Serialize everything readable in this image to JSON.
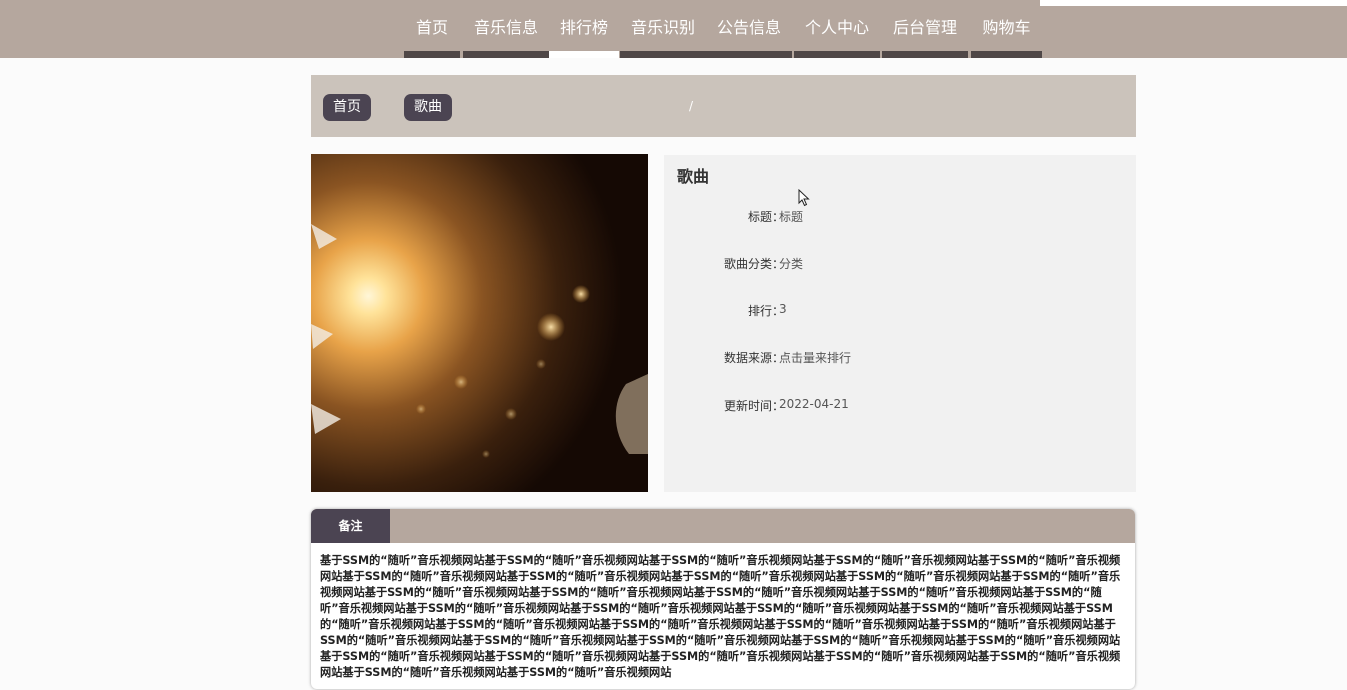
{
  "nav": {
    "items": [
      {
        "label": "首页"
      },
      {
        "label": "音乐信息"
      },
      {
        "label": "排行榜"
      },
      {
        "label": "音乐识别"
      },
      {
        "label": "公告信息"
      },
      {
        "label": "个人中心"
      },
      {
        "label": "后台管理"
      },
      {
        "label": "购物车"
      }
    ],
    "active_index": 2
  },
  "breadcrumb": {
    "items": [
      {
        "label": "首页"
      },
      {
        "label": "歌曲"
      }
    ],
    "separator": "/"
  },
  "detail": {
    "title": "歌曲",
    "fields": [
      {
        "label": "标题：",
        "value": "标题"
      },
      {
        "label": "歌曲分类：",
        "value": "分类"
      },
      {
        "label": "排行：",
        "value": "3"
      },
      {
        "label": "数据来源：",
        "value": "点击量来排行"
      },
      {
        "label": "更新时间：",
        "value": "2022-04-21"
      }
    ]
  },
  "remarks": {
    "tab_label": "备注",
    "content": "基于SSM的“随听”音乐视频网站基于SSM的“随听”音乐视频网站基于SSM的“随听”音乐视频网站基于SSM的“随听”音乐视频网站基于SSM的“随听”音乐视频网站基于SSM的“随听”音乐视频网站基于SSM的“随听”音乐视频网站基于SSM的“随听”音乐视频网站基于SSM的“随听”音乐视频网站基于SSM的“随听”音乐视频网站基于SSM的“随听”音乐视频网站基于SSM的“随听”音乐视频网站基于SSM的“随听”音乐视频网站基于SSM的“随听”音乐视频网站基于SSM的“随听”音乐视频网站基于SSM的“随听”音乐视频网站基于SSM的“随听”音乐视频网站基于SSM的“随听”音乐视频网站基于SSM的“随听”音乐视频网站基于SSM的“随听”音乐视频网站基于SSM的“随听”音乐视频网站基于SSM的“随听”音乐视频网站基于SSM的“随听”音乐视频网站基于SSM的“随听”音乐视频网站基于SSM的“随听”音乐视频网站基于SSM的“随听”音乐视频网站基于SSM的“随听”音乐视频网站基于SSM的“随听”音乐视频网站基于SSM的“随听”音乐视频网站基于SSM的“随听”音乐视频网站基于SSM的“随听”音乐视频网站基于SSM的“随听”音乐视频网站基于SSM的“随听”音乐视频网站基于SSM的“随听”音乐视频网站基于SSM的“随听”音乐视频网站基于SSM的“随听”音乐视频网站"
  },
  "colors": {
    "topbar": "#b5a79e",
    "nav_strip": "#4f4747",
    "breadcrumb_bg": "#cbc3bb",
    "pill": "#4b4452",
    "detail_bg": "#f1f1f1"
  }
}
